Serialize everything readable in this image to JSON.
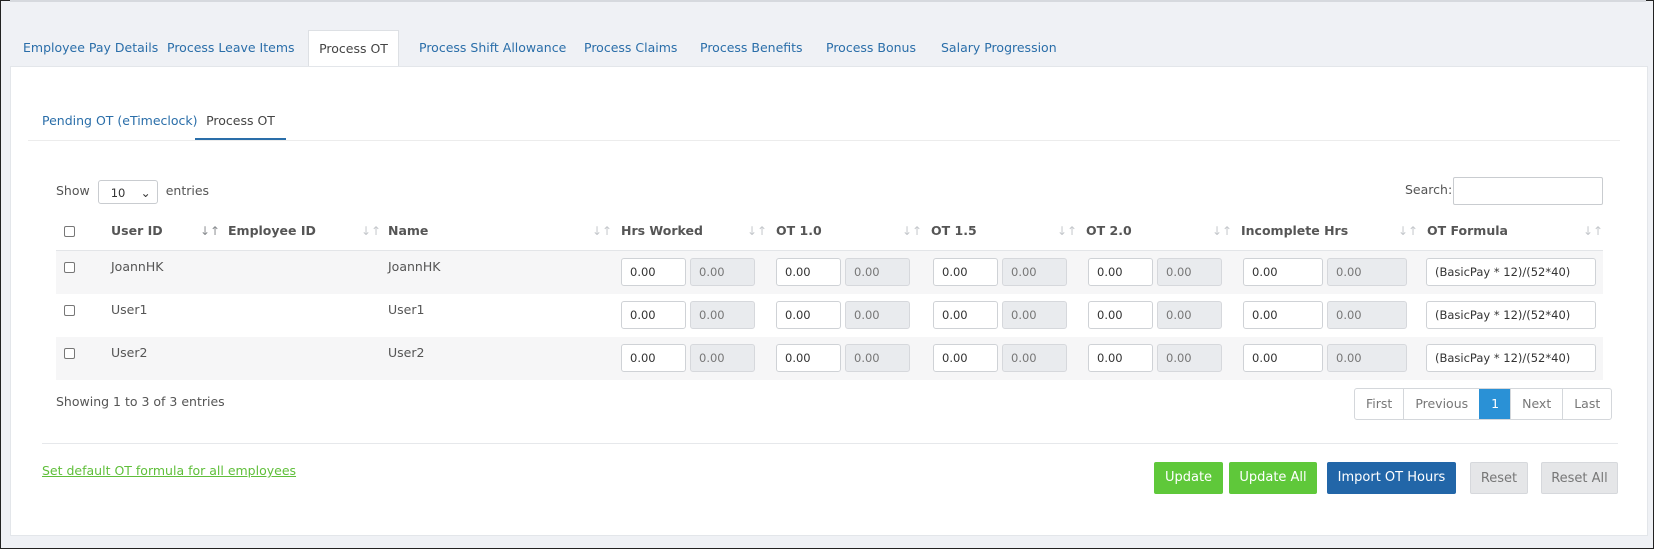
{
  "main_tabs": [
    "Employee Pay Details",
    "Process Leave Items",
    "Process OT",
    "Process Shift Allowance",
    "Process Claims",
    "Process Benefits",
    "Process Bonus",
    "Salary Progression"
  ],
  "main_tab_active": "Process OT",
  "sub_tabs": [
    "Pending OT (eTimeclock)",
    "Process OT"
  ],
  "sub_tab_active": "Process OT",
  "length": {
    "show": "Show",
    "value": "10",
    "entries": "entries"
  },
  "search": {
    "label": "Search:",
    "value": ""
  },
  "columns": [
    "User ID",
    "Employee ID",
    "Name",
    "Hrs Worked",
    "OT 1.0",
    "OT 1.5",
    "OT 2.0",
    "Incomplete Hrs",
    "OT Formula"
  ],
  "rows": [
    {
      "user_id": "JoannHK",
      "employee_id": "",
      "name": "JoannHK",
      "hrs_worked": "0.00",
      "hrs_worked_total": "0.00",
      "ot10": "0.00",
      "ot10_total": "0.00",
      "ot15": "0.00",
      "ot15_total": "0.00",
      "ot20": "0.00",
      "ot20_total": "0.00",
      "incomplete": "0.00",
      "incomplete_total": "0.00",
      "formula": "(BasicPay * 12)/(52*40)"
    },
    {
      "user_id": "User1",
      "employee_id": "",
      "name": "User1",
      "hrs_worked": "0.00",
      "hrs_worked_total": "0.00",
      "ot10": "0.00",
      "ot10_total": "0.00",
      "ot15": "0.00",
      "ot15_total": "0.00",
      "ot20": "0.00",
      "ot20_total": "0.00",
      "incomplete": "0.00",
      "incomplete_total": "0.00",
      "formula": "(BasicPay * 12)/(52*40)"
    },
    {
      "user_id": "User2",
      "employee_id": "",
      "name": "User2",
      "hrs_worked": "0.00",
      "hrs_worked_total": "0.00",
      "ot10": "0.00",
      "ot10_total": "0.00",
      "ot15": "0.00",
      "ot15_total": "0.00",
      "ot20": "0.00",
      "ot20_total": "0.00",
      "incomplete": "0.00",
      "incomplete_total": "0.00",
      "formula": "(BasicPay * 12)/(52*40)"
    }
  ],
  "info": "Showing 1 to 3 of 3 entries",
  "pagination": {
    "first": "First",
    "previous": "Previous",
    "current": "1",
    "next": "Next",
    "last": "Last"
  },
  "default_formula_link": "Set default OT formula for all employees",
  "buttons": {
    "update": "Update",
    "update_all": "Update All",
    "import": "Import OT Hours",
    "reset": "Reset",
    "reset_all": "Reset All"
  },
  "colors": {
    "link": "#2a6ea9",
    "green": "#5fc83a",
    "blue": "#2266a8",
    "page_active": "#2a91d6"
  }
}
